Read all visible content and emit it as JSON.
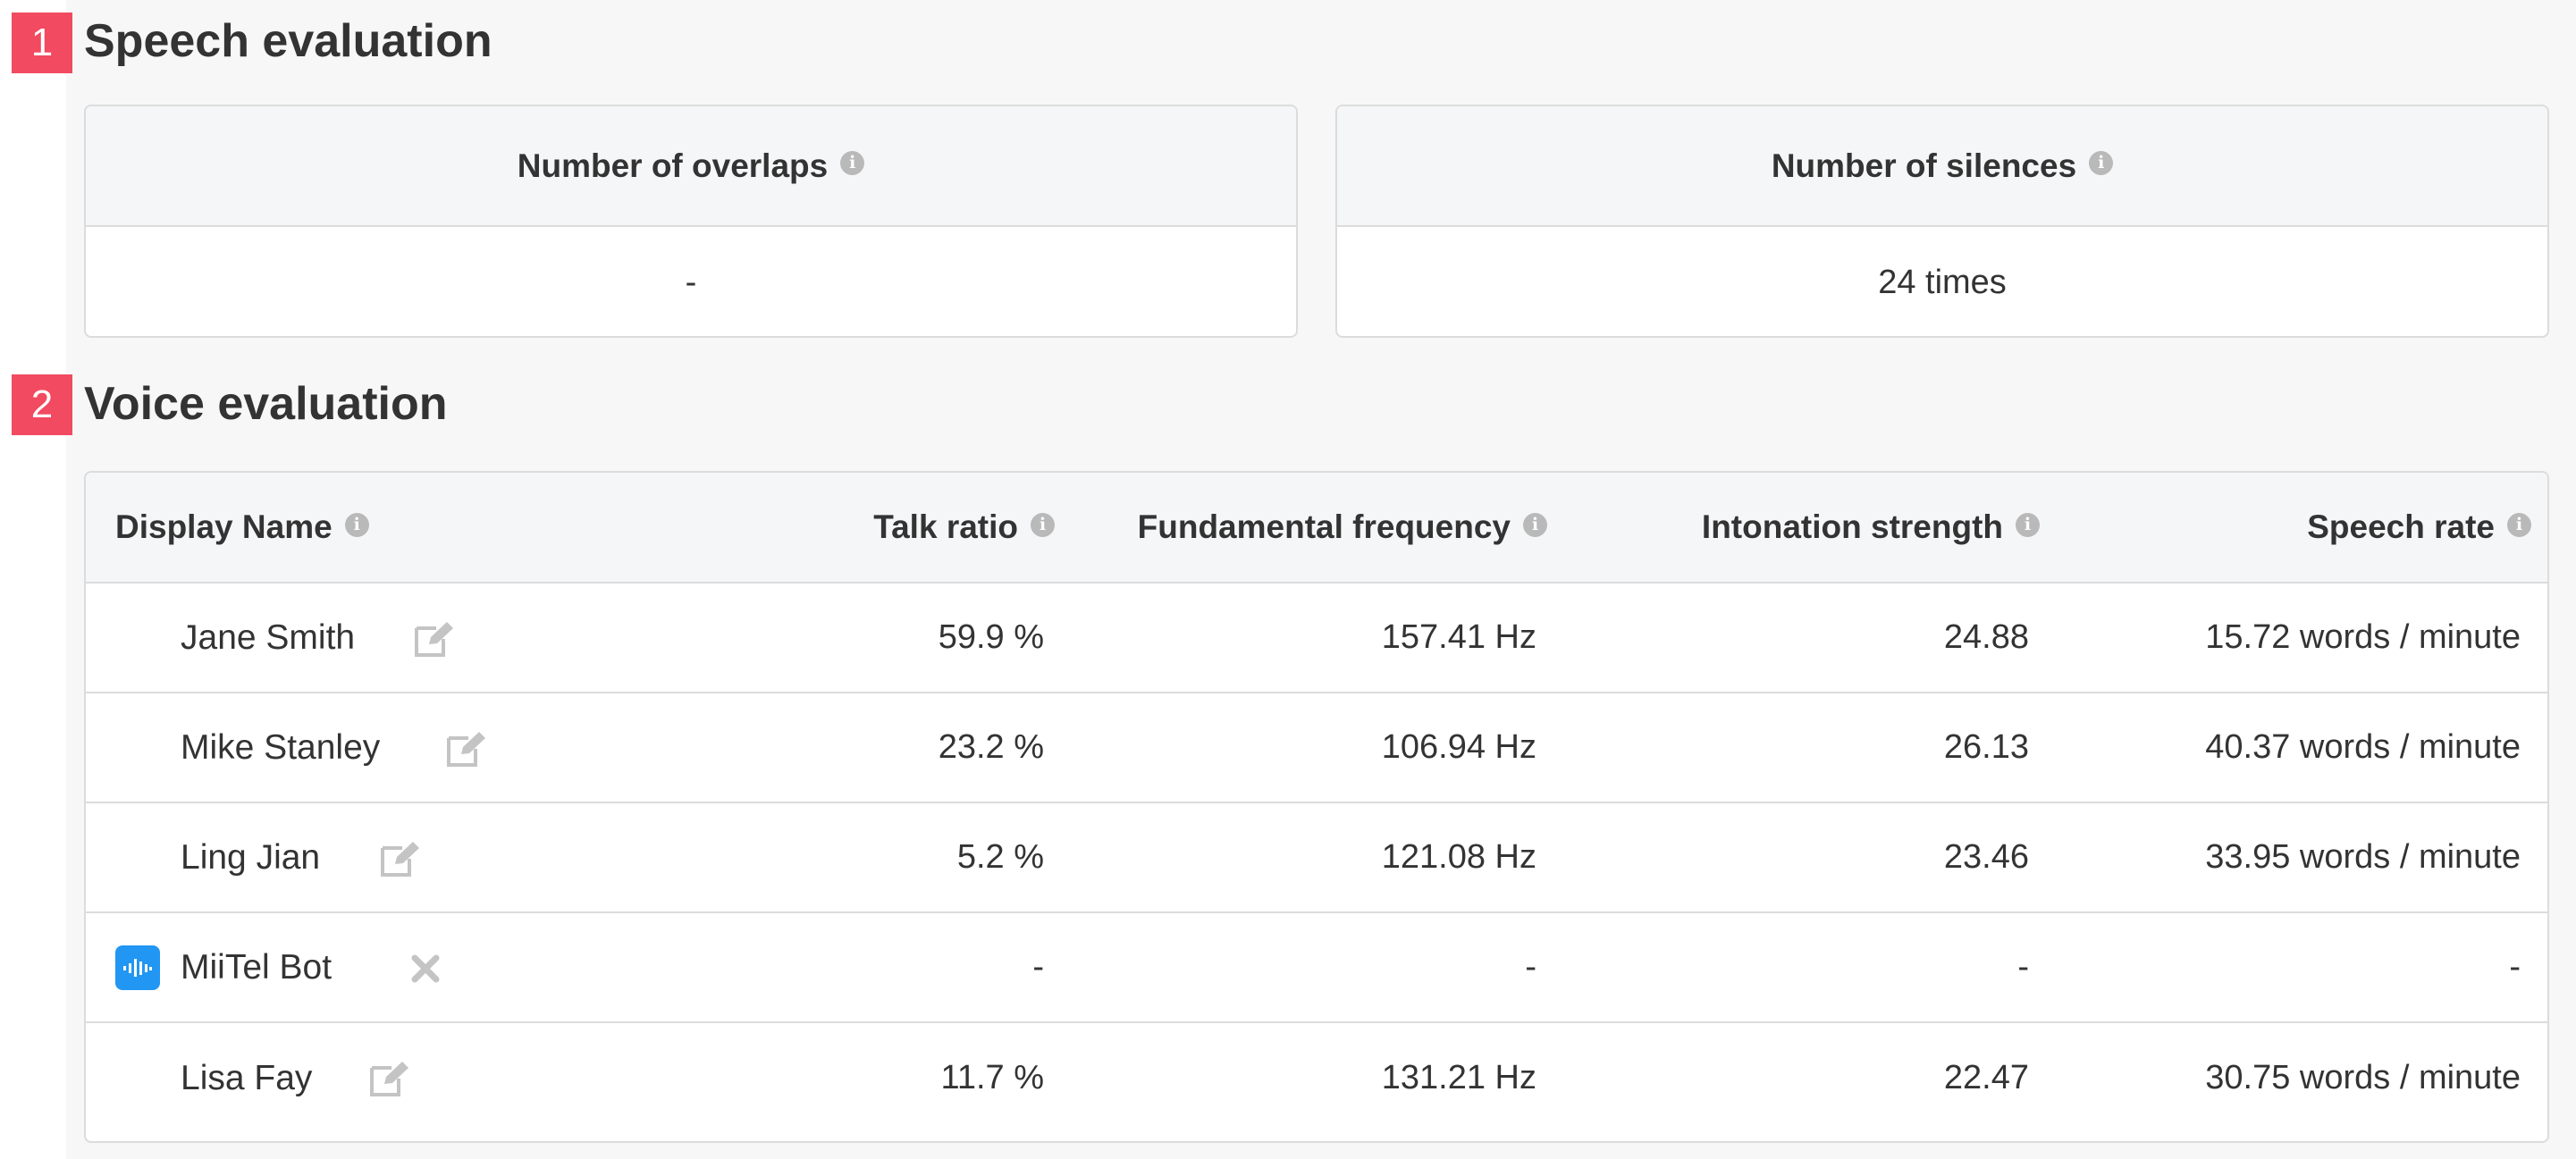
{
  "sections": [
    {
      "number": "1",
      "title": "Speech evaluation"
    },
    {
      "number": "2",
      "title": "Voice evaluation"
    }
  ],
  "speech_cards": [
    {
      "label": "Number of overlaps",
      "value": "-"
    },
    {
      "label": "Number of silences",
      "value": "24 times"
    }
  ],
  "voice_table": {
    "headers": [
      "Display Name",
      "Talk ratio",
      "Fundamental frequency",
      "Intonation strength",
      "Speech rate"
    ],
    "rows": [
      {
        "name": "Jane Smith",
        "talk": "59.9 %",
        "freq": "157.41 Hz",
        "inton": "24.88",
        "rate": "15.72 words / minute",
        "action": "edit-icon"
      },
      {
        "name": "Mike Stanley",
        "talk": "23.2 %",
        "freq": "106.94 Hz",
        "inton": "26.13",
        "rate": "40.37 words / minute",
        "action": "edit-icon"
      },
      {
        "name": "Ling Jian",
        "talk": "5.2 %",
        "freq": "121.08 Hz",
        "inton": "23.46",
        "rate": "33.95 words / minute",
        "action": "edit-icon"
      },
      {
        "name": "MiiTel Bot",
        "talk": "-",
        "freq": "-",
        "inton": "-",
        "rate": "-",
        "action": "close-icon",
        "avatar": "bot-icon"
      },
      {
        "name": "Lisa Fay",
        "talk": "11.7 %",
        "freq": "131.21 Hz",
        "inton": "22.47",
        "rate": "30.75 words / minute",
        "action": "edit-icon"
      }
    ]
  },
  "colors": {
    "marker": "#f24a60",
    "bot_icon": "#2196f3",
    "info_icon": "#b9b9b9"
  }
}
